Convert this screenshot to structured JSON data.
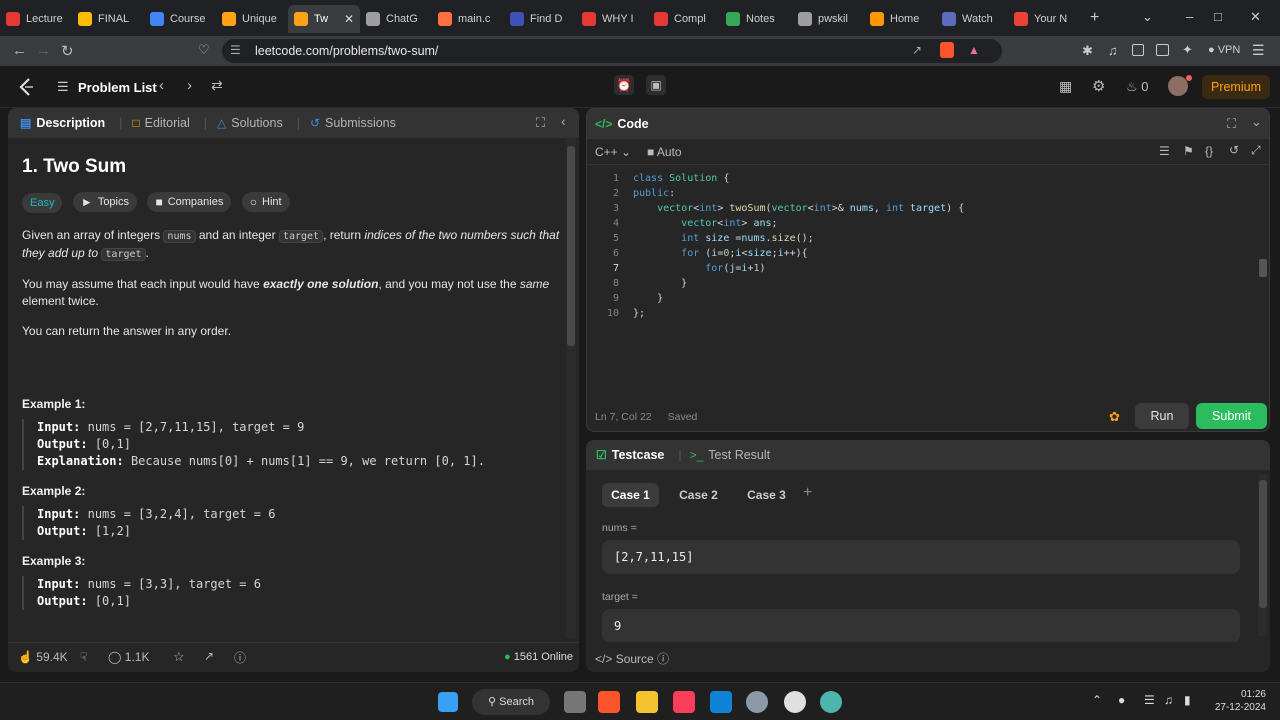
{
  "browser": {
    "tabs": [
      {
        "label": "Lecture",
        "color": "#e53935",
        "icon": "youtube-icon"
      },
      {
        "label": "FINAL",
        "color": "#fbbc04",
        "icon": "drive-icon"
      },
      {
        "label": "Course",
        "color": "#4285f4",
        "icon": "drive-icon"
      },
      {
        "label": "Unique",
        "color": "#ffa116",
        "icon": "leetcode-icon"
      },
      {
        "label": "Tw",
        "color": "#ffa116",
        "icon": "leetcode-icon"
      },
      {
        "label": "ChatG",
        "color": "#9e9e9e",
        "icon": "chatgpt-icon"
      },
      {
        "label": "main.c",
        "color": "#ff7043",
        "icon": "git-icon"
      },
      {
        "label": "Find D",
        "color": "#3f51b5",
        "icon": "find-icon"
      },
      {
        "label": "WHY I",
        "color": "#e53935",
        "icon": "youtube-icon"
      },
      {
        "label": "Compl",
        "color": "#e53935",
        "icon": "youtube-icon"
      },
      {
        "label": "Notes",
        "color": "#34a853",
        "icon": "drive-icon"
      },
      {
        "label": "pwskil",
        "color": "#9e9e9e",
        "icon": "pwskills-icon"
      },
      {
        "label": "Home",
        "color": "#ff9800",
        "icon": "gear-icon"
      },
      {
        "label": "Watch",
        "color": "#5c6bc0",
        "icon": "hianime-icon"
      },
      {
        "label": "Your N",
        "color": "#ea4335",
        "icon": "gmail-icon"
      }
    ],
    "url": "leetcode.com/problems/two-sum/",
    "vpn": "VPN"
  },
  "nav": {
    "problem_list": "Problem List",
    "streak": "0",
    "premium": "Premium"
  },
  "left": {
    "tabs": [
      "Description",
      "Editorial",
      "Solutions",
      "Submissions"
    ],
    "title": "1. Two Sum",
    "difficulty": "Easy",
    "chips": [
      "Topics",
      "Companies",
      "Hint"
    ],
    "para1_a": "Given an array of integers",
    "para1_code1": "nums",
    "para1_b": "and an integer",
    "para1_code2": "target",
    "para1_c": ", return",
    "para1_italic": "indices of the two numbers such that they add up to",
    "para1_code3": "target",
    "para1_d": ".",
    "para2_a": "You may assume that each input would have",
    "para2_bold": "exactly one solution",
    "para2_b": ", and you may not use the",
    "para2_italic": "same",
    "para2_c": "element twice.",
    "para3": "You can return the answer in any order.",
    "examples": [
      {
        "title": "Example 1:",
        "input": "nums = [2,7,11,15], target = 9",
        "output": "[0,1]",
        "explanation": "Because nums[0] + nums[1] == 9, we return [0, 1]."
      },
      {
        "title": "Example 2:",
        "input": "nums = [3,2,4], target = 6",
        "output": "[1,2]"
      },
      {
        "title": "Example 3:",
        "input": "nums = [3,3], target = 6",
        "output": "[0,1]"
      }
    ],
    "labels": {
      "input": "Input:",
      "output": "Output:",
      "explanation": "Explanation:"
    },
    "likes": "59.4K",
    "comments": "1.1K",
    "online": "1561 Online"
  },
  "code": {
    "title": "Code",
    "language": "C++",
    "auto": "Auto",
    "status_pos": "Ln 7, Col 22",
    "status_saved": "Saved",
    "run": "Run",
    "submit": "Submit",
    "line_numbers": [
      "1",
      "2",
      "3",
      "4",
      "5",
      "6",
      "7",
      "8",
      "9",
      "10"
    ]
  },
  "testcase": {
    "tab1": "Testcase",
    "tab2": "Test Result",
    "cases": [
      "Case 1",
      "Case 2",
      "Case 3"
    ],
    "nums_label": "nums =",
    "nums_value": "[2,7,11,15]",
    "target_label": "target =",
    "target_value": "9",
    "source": "Source"
  },
  "taskbar": {
    "search": "Search",
    "time": "01:26",
    "date": "27-12-2024"
  }
}
